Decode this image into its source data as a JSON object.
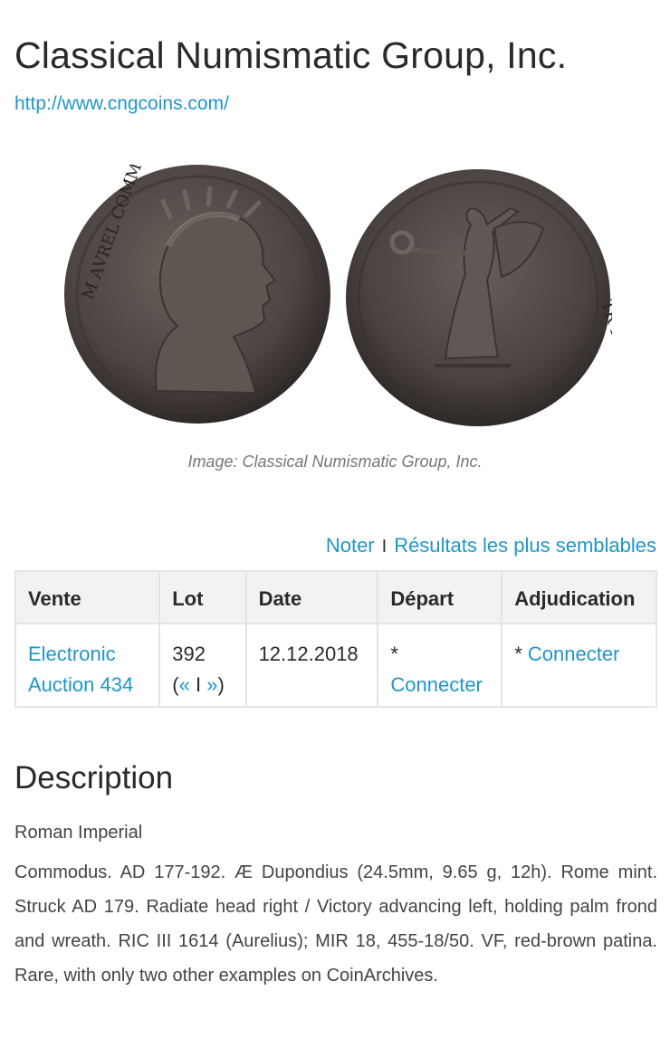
{
  "header": {
    "title": "Classical Numismatic Group, Inc.",
    "url": "http://www.cngcoins.com/"
  },
  "image": {
    "caption": "Image: Classical Numismatic Group, Inc.",
    "obverse_legend": "M AVREL COMMODO",
    "reverse_legend": "TR P III COS II P P"
  },
  "actions": {
    "rate": "Noter",
    "separator": "I",
    "similar": "Résultats les plus semblables"
  },
  "table": {
    "headers": [
      "Vente",
      "Lot",
      "Date",
      "Départ",
      "Adjudication"
    ],
    "row": {
      "sale_line1": "Electronic",
      "sale_line2": "Auction 434",
      "lot": "392",
      "lot_nav_open": "(",
      "lot_prev": "«",
      "lot_sep": "I",
      "lot_next": "»",
      "lot_nav_close": ")",
      "date": "12.12.2018",
      "start_star": "*",
      "start_link": "Connecter",
      "hammer_star": "* ",
      "hammer_link": "Connecter"
    }
  },
  "description": {
    "heading": "Description",
    "category": "Roman Imperial",
    "text": "Commodus. AD 177-192. Æ Dupondius (24.5mm, 9.65 g, 12h). Rome mint. Struck AD 179. Radiate head right / Victory advancing left, holding palm frond and wreath. RIC III 1614 (Aurelius); MIR 18, 455-18/50. VF, red-brown patina. Rare, with only two other examples on CoinArchives."
  }
}
